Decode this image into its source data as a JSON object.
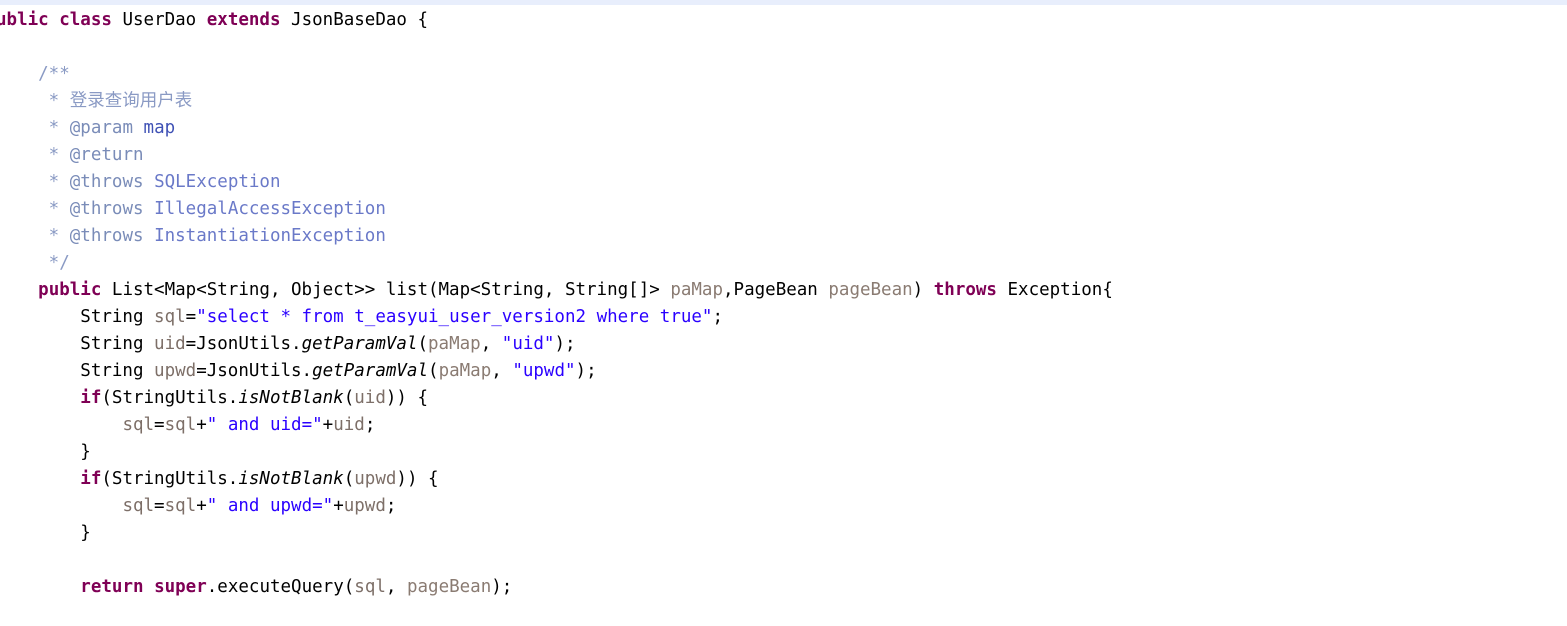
{
  "editor": {
    "language": "java",
    "file_title": "UserDao.java",
    "background_color": "#ffffff",
    "top_edge_color": "#e8eefc",
    "horizontally_scrolled": true
  },
  "palette": {
    "keyword": "#7f0055",
    "string": "#2a00ff",
    "comment": "#8a9ac4",
    "comment_tag": "#7a8cb8",
    "parameter": "#8a7b72",
    "local_variable": "#7d6f68",
    "plain": "#000000"
  },
  "code": {
    "lines": [
      {
        "id": "class-decl",
        "tokens": [
          {
            "t": "ublic",
            "c": "kw"
          },
          {
            "t": " ",
            "c": "plain"
          },
          {
            "t": "class",
            "c": "kw"
          },
          {
            "t": " UserDao ",
            "c": "plain"
          },
          {
            "t": "extends",
            "c": "kw"
          },
          {
            "t": " JsonBaseDao {",
            "c": "plain"
          }
        ]
      },
      {
        "id": "blank-1",
        "tokens": [
          {
            "t": "",
            "c": "plain"
          }
        ]
      },
      {
        "id": "javadoc-open",
        "tokens": [
          {
            "t": "    /**",
            "c": "cmt"
          }
        ]
      },
      {
        "id": "javadoc-summary",
        "tokens": [
          {
            "t": "     * ",
            "c": "cmt"
          },
          {
            "t": "登录查询用户表",
            "c": "cmt"
          }
        ]
      },
      {
        "id": "javadoc-param",
        "tokens": [
          {
            "t": "     * ",
            "c": "cmt"
          },
          {
            "t": "@param",
            "c": "cmt-tag"
          },
          {
            "t": " ",
            "c": "cmt"
          },
          {
            "t": "map",
            "c": "cmt-link"
          }
        ]
      },
      {
        "id": "javadoc-return",
        "tokens": [
          {
            "t": "     * ",
            "c": "cmt"
          },
          {
            "t": "@return",
            "c": "cmt-tag"
          }
        ]
      },
      {
        "id": "javadoc-throws-sql",
        "tokens": [
          {
            "t": "     * ",
            "c": "cmt"
          },
          {
            "t": "@throws",
            "c": "cmt-tag"
          },
          {
            "t": " ",
            "c": "cmt"
          },
          {
            "t": "SQLException",
            "c": "cmt-ref"
          }
        ]
      },
      {
        "id": "javadoc-throws-illegalaccess",
        "tokens": [
          {
            "t": "     * ",
            "c": "cmt"
          },
          {
            "t": "@throws",
            "c": "cmt-tag"
          },
          {
            "t": " ",
            "c": "cmt"
          },
          {
            "t": "IllegalAccessException",
            "c": "cmt-ref"
          }
        ]
      },
      {
        "id": "javadoc-throws-instantiation",
        "tokens": [
          {
            "t": "     * ",
            "c": "cmt"
          },
          {
            "t": "@throws",
            "c": "cmt-tag"
          },
          {
            "t": " ",
            "c": "cmt"
          },
          {
            "t": "InstantiationException",
            "c": "cmt-ref"
          }
        ]
      },
      {
        "id": "javadoc-close",
        "tokens": [
          {
            "t": "     */",
            "c": "cmt"
          }
        ]
      },
      {
        "id": "method-signature",
        "tokens": [
          {
            "t": "    ",
            "c": "plain"
          },
          {
            "t": "public",
            "c": "kw"
          },
          {
            "t": " List<Map<String, Object>> list(Map<String, String[]> ",
            "c": "plain"
          },
          {
            "t": "paMap",
            "c": "param"
          },
          {
            "t": ",PageBean ",
            "c": "plain"
          },
          {
            "t": "pageBean",
            "c": "param"
          },
          {
            "t": ") ",
            "c": "plain"
          },
          {
            "t": "throws",
            "c": "kw"
          },
          {
            "t": " Exception{",
            "c": "plain"
          }
        ]
      },
      {
        "id": "sql-init",
        "tokens": [
          {
            "t": "        String ",
            "c": "plain"
          },
          {
            "t": "sql",
            "c": "localvar"
          },
          {
            "t": "=",
            "c": "plain"
          },
          {
            "t": "\"select * from t_easyui_user_version2 where true\"",
            "c": "str"
          },
          {
            "t": ";",
            "c": "plain"
          }
        ]
      },
      {
        "id": "uid-init",
        "tokens": [
          {
            "t": "        String ",
            "c": "plain"
          },
          {
            "t": "uid",
            "c": "localvar"
          },
          {
            "t": "=JsonUtils.",
            "c": "plain"
          },
          {
            "t": "getParamVal",
            "c": "static-m"
          },
          {
            "t": "(",
            "c": "plain"
          },
          {
            "t": "paMap",
            "c": "param"
          },
          {
            "t": ", ",
            "c": "plain"
          },
          {
            "t": "\"uid\"",
            "c": "str"
          },
          {
            "t": ");",
            "c": "plain"
          }
        ]
      },
      {
        "id": "upwd-init",
        "tokens": [
          {
            "t": "        String ",
            "c": "plain"
          },
          {
            "t": "upwd",
            "c": "localvar"
          },
          {
            "t": "=JsonUtils.",
            "c": "plain"
          },
          {
            "t": "getParamVal",
            "c": "static-m"
          },
          {
            "t": "(",
            "c": "plain"
          },
          {
            "t": "paMap",
            "c": "param"
          },
          {
            "t": ", ",
            "c": "plain"
          },
          {
            "t": "\"upwd\"",
            "c": "str"
          },
          {
            "t": ");",
            "c": "plain"
          }
        ]
      },
      {
        "id": "if-uid",
        "tokens": [
          {
            "t": "        ",
            "c": "plain"
          },
          {
            "t": "if",
            "c": "kw"
          },
          {
            "t": "(StringUtils.",
            "c": "plain"
          },
          {
            "t": "isNotBlank",
            "c": "static-m"
          },
          {
            "t": "(",
            "c": "plain"
          },
          {
            "t": "uid",
            "c": "localvar"
          },
          {
            "t": ")) {",
            "c": "plain"
          }
        ]
      },
      {
        "id": "append-uid",
        "tokens": [
          {
            "t": "            ",
            "c": "plain"
          },
          {
            "t": "sql",
            "c": "localvar"
          },
          {
            "t": "=",
            "c": "plain"
          },
          {
            "t": "sql",
            "c": "localvar"
          },
          {
            "t": "+",
            "c": "plain"
          },
          {
            "t": "\" and uid=\"",
            "c": "str"
          },
          {
            "t": "+",
            "c": "plain"
          },
          {
            "t": "uid",
            "c": "localvar"
          },
          {
            "t": ";",
            "c": "plain"
          }
        ]
      },
      {
        "id": "close-if-uid",
        "tokens": [
          {
            "t": "        }",
            "c": "plain"
          }
        ]
      },
      {
        "id": "if-upwd",
        "tokens": [
          {
            "t": "        ",
            "c": "plain"
          },
          {
            "t": "if",
            "c": "kw"
          },
          {
            "t": "(StringUtils.",
            "c": "plain"
          },
          {
            "t": "isNotBlank",
            "c": "static-m"
          },
          {
            "t": "(",
            "c": "plain"
          },
          {
            "t": "upwd",
            "c": "localvar"
          },
          {
            "t": ")) {",
            "c": "plain"
          }
        ]
      },
      {
        "id": "append-upwd",
        "tokens": [
          {
            "t": "            ",
            "c": "plain"
          },
          {
            "t": "sql",
            "c": "localvar"
          },
          {
            "t": "=",
            "c": "plain"
          },
          {
            "t": "sql",
            "c": "localvar"
          },
          {
            "t": "+",
            "c": "plain"
          },
          {
            "t": "\" and upwd=\"",
            "c": "str"
          },
          {
            "t": "+",
            "c": "plain"
          },
          {
            "t": "upwd",
            "c": "localvar"
          },
          {
            "t": ";",
            "c": "plain"
          }
        ]
      },
      {
        "id": "close-if-upwd",
        "tokens": [
          {
            "t": "        }",
            "c": "plain"
          }
        ]
      },
      {
        "id": "blank-2",
        "tokens": [
          {
            "t": "",
            "c": "plain"
          }
        ]
      },
      {
        "id": "return-stmt",
        "tokens": [
          {
            "t": "        ",
            "c": "plain"
          },
          {
            "t": "return",
            "c": "kw"
          },
          {
            "t": " ",
            "c": "plain"
          },
          {
            "t": "super",
            "c": "kw"
          },
          {
            "t": ".",
            "c": "plain"
          },
          {
            "t": "executeQuery",
            "c": "method"
          },
          {
            "t": "(",
            "c": "plain"
          },
          {
            "t": "sql",
            "c": "localvar"
          },
          {
            "t": ", ",
            "c": "plain"
          },
          {
            "t": "pageBean",
            "c": "param"
          },
          {
            "t": ");",
            "c": "plain"
          }
        ]
      }
    ]
  }
}
